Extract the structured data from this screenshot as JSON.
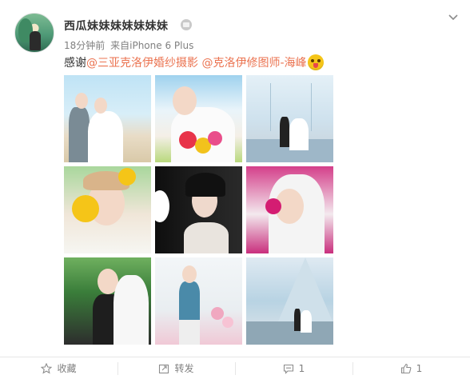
{
  "header": {
    "name": "西瓜妹妹妹妹妹妹妹",
    "time": "18分钟前",
    "source_prefix": "来自",
    "source": "iPhone 6 Plus"
  },
  "post": {
    "text_prefix": "感谢",
    "mention1": "@三亚克洛伊婚纱摄影",
    "mention2": "@克洛伊修图师-海峰",
    "emoji_icon": "crazy-face-emoji"
  },
  "photos": [
    {
      "alt": "couple-on-beach"
    },
    {
      "alt": "bride-with-bouquet"
    },
    {
      "alt": "glass-chapel-couple"
    },
    {
      "alt": "girl-with-sunflower"
    },
    {
      "alt": "bride-dark-portrait"
    },
    {
      "alt": "bride-with-flowers"
    },
    {
      "alt": "couple-in-garden"
    },
    {
      "alt": "groom-with-balloons"
    },
    {
      "alt": "glass-chapel-exterior"
    }
  ],
  "actions": {
    "favorite_label": "收藏",
    "repost_label": "转发",
    "comment_count": "1",
    "like_count": "1"
  },
  "colors": {
    "mention": "#eb7350",
    "meta": "#808080"
  }
}
